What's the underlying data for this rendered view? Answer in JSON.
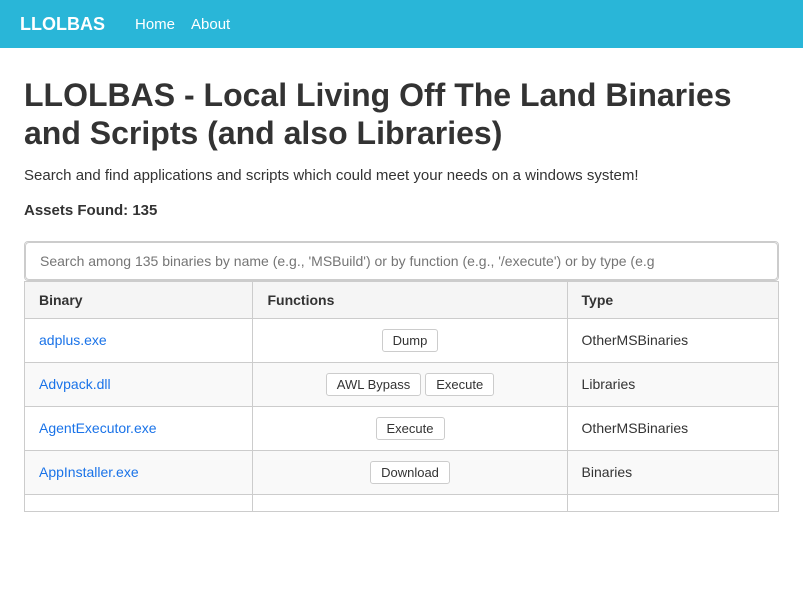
{
  "navbar": {
    "brand": "LLOLBAS",
    "links": [
      {
        "label": "Home",
        "href": "#"
      },
      {
        "label": "About",
        "href": "#"
      }
    ]
  },
  "page": {
    "title": "LLOLBAS - Local Living Off The Land Binaries and Scripts (and also Libraries)",
    "subtitle": "Search and find applications and scripts which could meet your needs on a windows system!",
    "assets_found_label": "Assets Found: 135",
    "search_placeholder": "Search among 135 binaries by name (e.g., 'MSBuild') or by function (e.g., '/execute') or by type (e.g"
  },
  "table": {
    "columns": [
      "Binary",
      "Functions",
      "Type"
    ],
    "rows": [
      {
        "binary": "adplus.exe",
        "functions": [
          "Dump"
        ],
        "type": "OtherMSBinaries"
      },
      {
        "binary": "Advpack.dll",
        "functions": [
          "AWL Bypass",
          "Execute"
        ],
        "type": "Libraries"
      },
      {
        "binary": "AgentExecutor.exe",
        "functions": [
          "Execute"
        ],
        "type": "OtherMSBinaries"
      },
      {
        "binary": "AppInstaller.exe",
        "functions": [
          "Download"
        ],
        "type": "Binaries"
      },
      {
        "binary": "",
        "functions": [],
        "type": ""
      }
    ]
  }
}
